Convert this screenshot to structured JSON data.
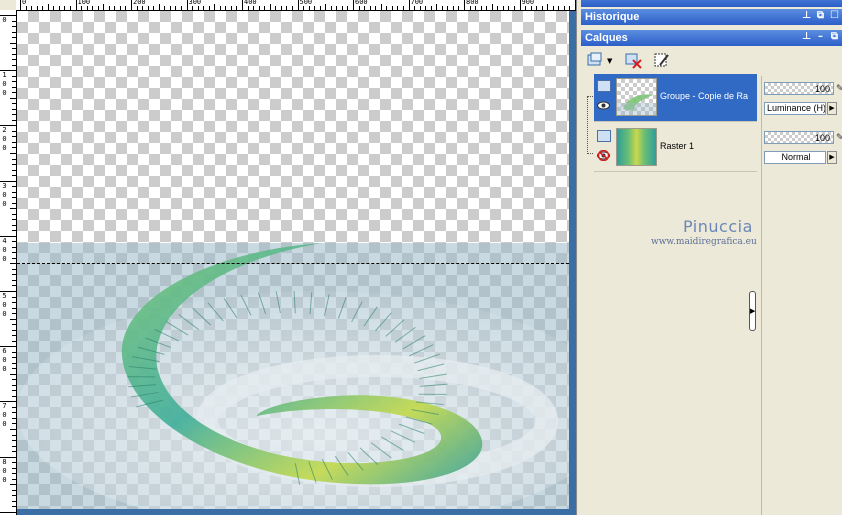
{
  "canvas": {
    "ruler_h_labels": [
      "0",
      "100",
      "200",
      "300",
      "400",
      "500",
      "600",
      "700",
      "800",
      "900"
    ],
    "ruler_v_labels": [
      [
        "0"
      ],
      [
        "1",
        "0",
        "0"
      ],
      [
        "2",
        "0",
        "0"
      ],
      [
        "3",
        "0",
        "0"
      ],
      [
        "4",
        "0",
        "0"
      ],
      [
        "5",
        "0",
        "0"
      ],
      [
        "6",
        "0",
        "0"
      ],
      [
        "7",
        "0",
        "0"
      ],
      [
        "8",
        "0",
        "0"
      ]
    ]
  },
  "palettes": {
    "history_title": "Historique",
    "layers_title": "Calques"
  },
  "layers": [
    {
      "name": "Groupe - Copie de Ra",
      "opacity": "100",
      "blend": "Luminance (H)",
      "selected": true,
      "visible": true
    },
    {
      "name": "Raster 1",
      "opacity": "100",
      "blend": "Normal",
      "selected": false,
      "visible": false
    }
  ],
  "watermark": {
    "title": "Pinuccia",
    "url": "www.maidiregrafica.eu"
  },
  "colors": {
    "title_bar": "#2c5fc8",
    "selection": "#316ac5",
    "panel_bg": "#ece9d8"
  }
}
